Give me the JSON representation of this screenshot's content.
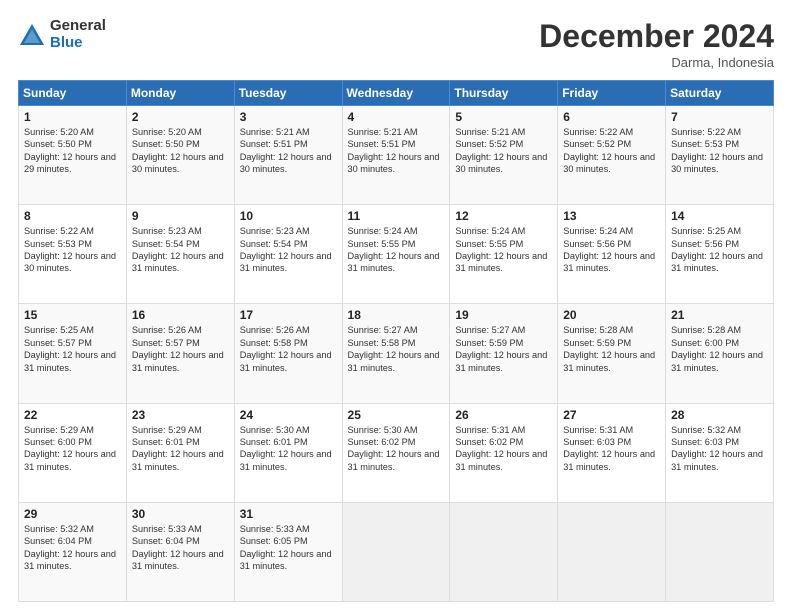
{
  "logo": {
    "general": "General",
    "blue": "Blue"
  },
  "header": {
    "title": "December 2024",
    "location": "Darma, Indonesia"
  },
  "weekdays": [
    "Sunday",
    "Monday",
    "Tuesday",
    "Wednesday",
    "Thursday",
    "Friday",
    "Saturday"
  ],
  "weeks": [
    [
      {
        "day": "1",
        "sunrise": "5:20 AM",
        "sunset": "5:50 PM",
        "daylight": "12 hours and 29 minutes."
      },
      {
        "day": "2",
        "sunrise": "5:20 AM",
        "sunset": "5:50 PM",
        "daylight": "12 hours and 30 minutes."
      },
      {
        "day": "3",
        "sunrise": "5:21 AM",
        "sunset": "5:51 PM",
        "daylight": "12 hours and 30 minutes."
      },
      {
        "day": "4",
        "sunrise": "5:21 AM",
        "sunset": "5:51 PM",
        "daylight": "12 hours and 30 minutes."
      },
      {
        "day": "5",
        "sunrise": "5:21 AM",
        "sunset": "5:52 PM",
        "daylight": "12 hours and 30 minutes."
      },
      {
        "day": "6",
        "sunrise": "5:22 AM",
        "sunset": "5:52 PM",
        "daylight": "12 hours and 30 minutes."
      },
      {
        "day": "7",
        "sunrise": "5:22 AM",
        "sunset": "5:53 PM",
        "daylight": "12 hours and 30 minutes."
      }
    ],
    [
      {
        "day": "8",
        "sunrise": "5:22 AM",
        "sunset": "5:53 PM",
        "daylight": "12 hours and 30 minutes."
      },
      {
        "day": "9",
        "sunrise": "5:23 AM",
        "sunset": "5:54 PM",
        "daylight": "12 hours and 31 minutes."
      },
      {
        "day": "10",
        "sunrise": "5:23 AM",
        "sunset": "5:54 PM",
        "daylight": "12 hours and 31 minutes."
      },
      {
        "day": "11",
        "sunrise": "5:24 AM",
        "sunset": "5:55 PM",
        "daylight": "12 hours and 31 minutes."
      },
      {
        "day": "12",
        "sunrise": "5:24 AM",
        "sunset": "5:55 PM",
        "daylight": "12 hours and 31 minutes."
      },
      {
        "day": "13",
        "sunrise": "5:24 AM",
        "sunset": "5:56 PM",
        "daylight": "12 hours and 31 minutes."
      },
      {
        "day": "14",
        "sunrise": "5:25 AM",
        "sunset": "5:56 PM",
        "daylight": "12 hours and 31 minutes."
      }
    ],
    [
      {
        "day": "15",
        "sunrise": "5:25 AM",
        "sunset": "5:57 PM",
        "daylight": "12 hours and 31 minutes."
      },
      {
        "day": "16",
        "sunrise": "5:26 AM",
        "sunset": "5:57 PM",
        "daylight": "12 hours and 31 minutes."
      },
      {
        "day": "17",
        "sunrise": "5:26 AM",
        "sunset": "5:58 PM",
        "daylight": "12 hours and 31 minutes."
      },
      {
        "day": "18",
        "sunrise": "5:27 AM",
        "sunset": "5:58 PM",
        "daylight": "12 hours and 31 minutes."
      },
      {
        "day": "19",
        "sunrise": "5:27 AM",
        "sunset": "5:59 PM",
        "daylight": "12 hours and 31 minutes."
      },
      {
        "day": "20",
        "sunrise": "5:28 AM",
        "sunset": "5:59 PM",
        "daylight": "12 hours and 31 minutes."
      },
      {
        "day": "21",
        "sunrise": "5:28 AM",
        "sunset": "6:00 PM",
        "daylight": "12 hours and 31 minutes."
      }
    ],
    [
      {
        "day": "22",
        "sunrise": "5:29 AM",
        "sunset": "6:00 PM",
        "daylight": "12 hours and 31 minutes."
      },
      {
        "day": "23",
        "sunrise": "5:29 AM",
        "sunset": "6:01 PM",
        "daylight": "12 hours and 31 minutes."
      },
      {
        "day": "24",
        "sunrise": "5:30 AM",
        "sunset": "6:01 PM",
        "daylight": "12 hours and 31 minutes."
      },
      {
        "day": "25",
        "sunrise": "5:30 AM",
        "sunset": "6:02 PM",
        "daylight": "12 hours and 31 minutes."
      },
      {
        "day": "26",
        "sunrise": "5:31 AM",
        "sunset": "6:02 PM",
        "daylight": "12 hours and 31 minutes."
      },
      {
        "day": "27",
        "sunrise": "5:31 AM",
        "sunset": "6:03 PM",
        "daylight": "12 hours and 31 minutes."
      },
      {
        "day": "28",
        "sunrise": "5:32 AM",
        "sunset": "6:03 PM",
        "daylight": "12 hours and 31 minutes."
      }
    ],
    [
      {
        "day": "29",
        "sunrise": "5:32 AM",
        "sunset": "6:04 PM",
        "daylight": "12 hours and 31 minutes."
      },
      {
        "day": "30",
        "sunrise": "5:33 AM",
        "sunset": "6:04 PM",
        "daylight": "12 hours and 31 minutes."
      },
      {
        "day": "31",
        "sunrise": "5:33 AM",
        "sunset": "6:05 PM",
        "daylight": "12 hours and 31 minutes."
      },
      null,
      null,
      null,
      null
    ]
  ]
}
